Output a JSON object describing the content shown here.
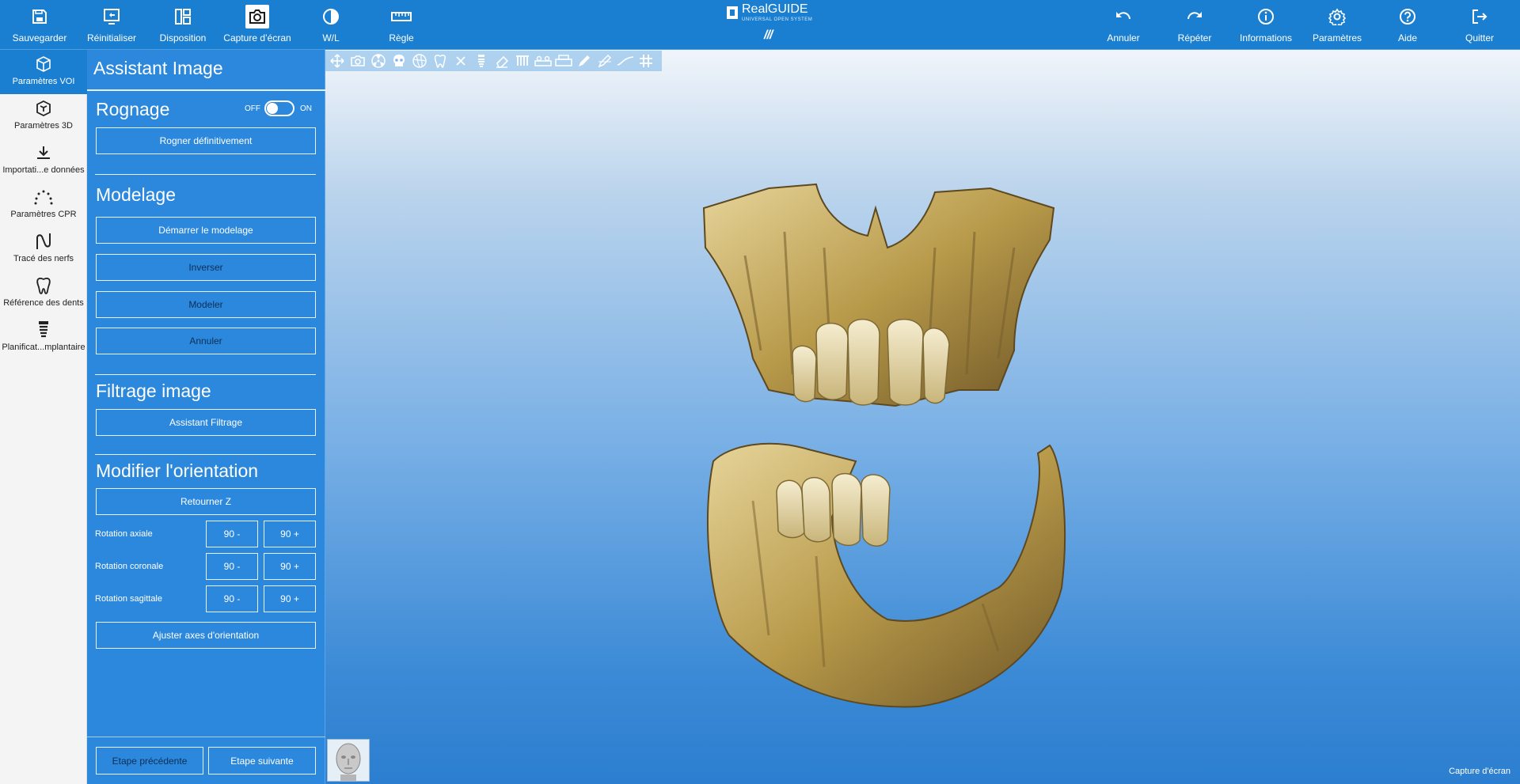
{
  "toolbar": {
    "save": "Sauvegarder",
    "reset": "Réinitialiser",
    "layout": "Disposition",
    "screenshot": "Capture d’écran",
    "wl": "W/L",
    "ruler": "Règle",
    "undo": "Annuler",
    "redo": "Répéter",
    "info": "Informations",
    "settings": "Paramètres",
    "help": "Aide",
    "quit": "Quitter"
  },
  "logo": {
    "name": "RealGUIDE",
    "sub": "UNIVERSAL OPEN SYSTEM",
    "slashes": "///"
  },
  "sidebar": {
    "items": [
      {
        "label": "Paramètres VOI",
        "icon": "cube-icon",
        "active": true
      },
      {
        "label": "Paramètres 3D",
        "icon": "cube-3d-icon",
        "active": false
      },
      {
        "label": "Importati...e données",
        "icon": "download-icon",
        "active": false
      },
      {
        "label": "Paramètres CPR",
        "icon": "arch-dots-icon",
        "active": false
      },
      {
        "label": "Tracé des nerfs",
        "icon": "nerve-icon",
        "active": false
      },
      {
        "label": "Référence des dents",
        "icon": "tooth-icon",
        "active": false
      },
      {
        "label": "Planificat...mplantaire",
        "icon": "implant-icon",
        "active": false
      }
    ]
  },
  "panel": {
    "title": "Assistant Image",
    "crop": {
      "title": "Rognage",
      "toggle_off": "OFF",
      "toggle_on": "ON",
      "toggle_state": "off",
      "button": "Rogner définitivement"
    },
    "modeling": {
      "title": "Modelage",
      "start": "Démarrer le modelage",
      "invert": "Inverser",
      "model": "Modeler",
      "cancel": "Annuler"
    },
    "filter": {
      "title": "Filtrage image",
      "button": "Assistant Filtrage"
    },
    "orientation": {
      "title": "Modifier l'orientation",
      "flip": "Retourner Z",
      "rows": [
        {
          "label": "Rotation axiale",
          "minus": "90 -",
          "plus": "90 +"
        },
        {
          "label": "Rotation coronale",
          "minus": "90 -",
          "plus": "90 +"
        },
        {
          "label": "Rotation sagittale",
          "minus": "90 -",
          "plus": "90 +"
        }
      ],
      "adjust": "Ajuster axes d'orientation"
    },
    "prev": "Etape précédente",
    "next": "Etape suivante"
  },
  "viewport": {
    "capture_label": "Capture d'écran",
    "tools": [
      "move-icon",
      "camera-icon",
      "radiation-icon",
      "skull-icon",
      "globe-icon",
      "tooth-outline-icon",
      "close-icon",
      "implant-small-icon",
      "eraser-icon",
      "teeth-row-icon",
      "panoramic-icon",
      "panoramic-alt-icon",
      "pen-icon",
      "pen-alt-icon",
      "curve-icon",
      "grid-icon"
    ]
  }
}
